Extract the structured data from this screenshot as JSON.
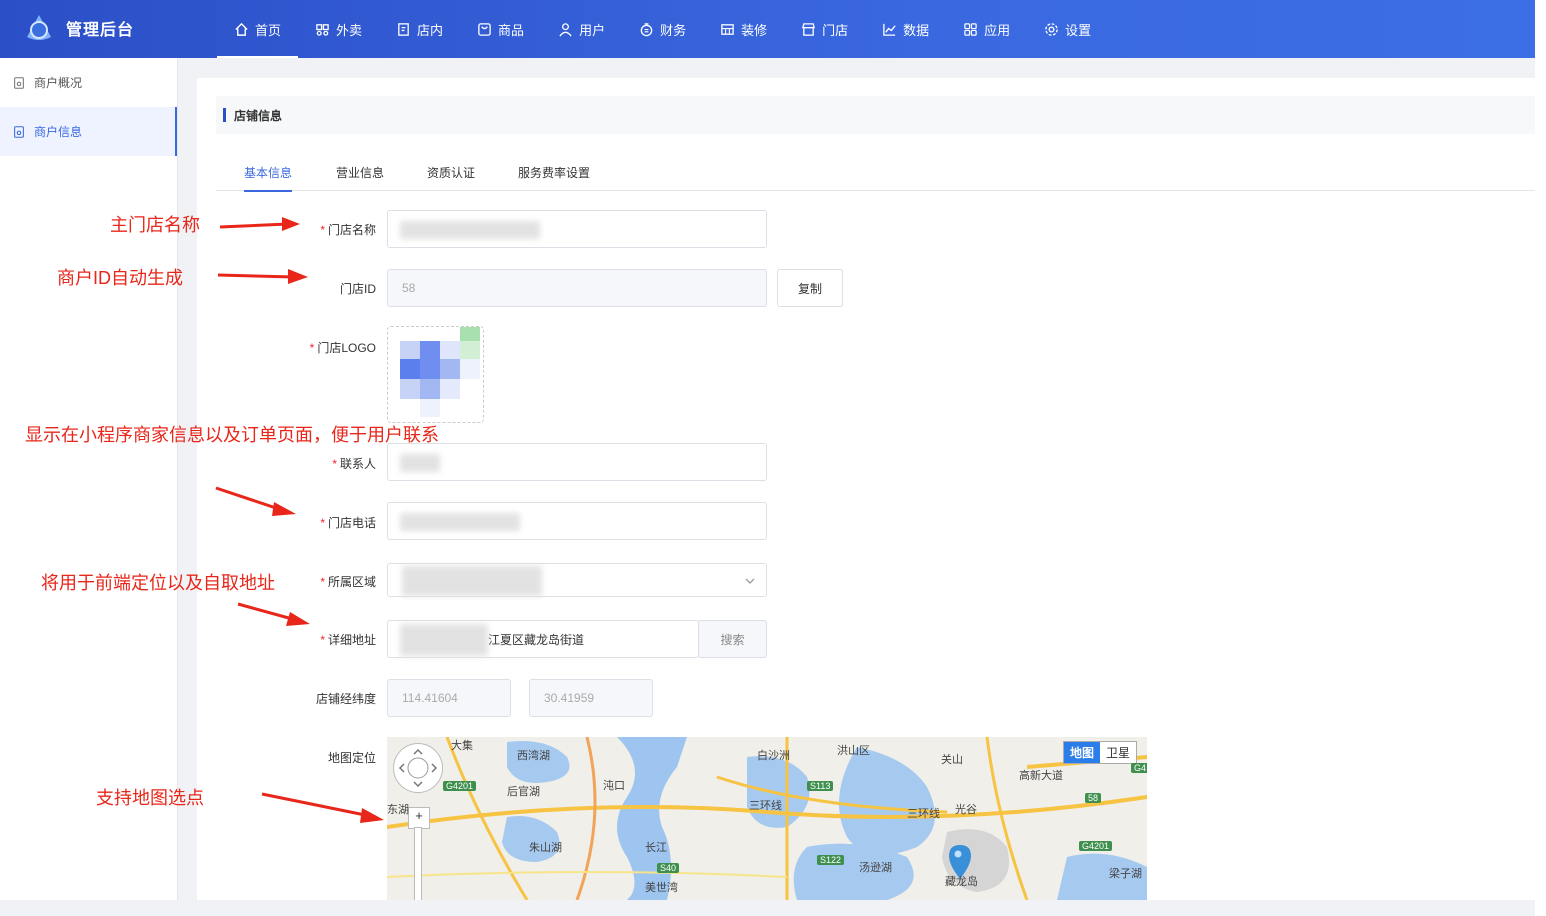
{
  "brand": {
    "title": "管理后台"
  },
  "nav": [
    {
      "label": "首页",
      "icon": "home-icon"
    },
    {
      "label": "外卖",
      "icon": "delivery-icon"
    },
    {
      "label": "店内",
      "icon": "dine-in-icon"
    },
    {
      "label": "商品",
      "icon": "goods-icon"
    },
    {
      "label": "用户",
      "icon": "user-icon"
    },
    {
      "label": "财务",
      "icon": "finance-icon"
    },
    {
      "label": "装修",
      "icon": "decorate-icon"
    },
    {
      "label": "门店",
      "icon": "store-icon"
    },
    {
      "label": "数据",
      "icon": "chart-icon"
    },
    {
      "label": "应用",
      "icon": "apps-icon"
    },
    {
      "label": "设置",
      "icon": "gear-icon"
    }
  ],
  "sidebar": {
    "items": [
      {
        "label": "商户概况"
      },
      {
        "label": "商户信息"
      }
    ]
  },
  "section": {
    "title": "店铺信息"
  },
  "tabs": [
    {
      "label": "基本信息"
    },
    {
      "label": "营业信息"
    },
    {
      "label": "资质认证"
    },
    {
      "label": "服务费率设置"
    }
  ],
  "form": {
    "store_name_label": "门店名称",
    "store_id_label": "门店ID",
    "store_id_value": "58",
    "copy_button": "复制",
    "logo_label": "门店LOGO",
    "contact_label": "联系人",
    "phone_label": "门店电话",
    "region_label": "所属区域",
    "address_label": "详细地址",
    "address_value": "江夏区藏龙岛街道",
    "search_button": "搜索",
    "coords_label": "店铺经纬度",
    "longitude": "114.41604",
    "latitude": "30.41959",
    "map_label": "地图定位"
  },
  "annotations": {
    "store_name": "主门店名称",
    "store_id": "商户ID自动生成",
    "contact_info": "显示在小程序商家信息以及订单页面，便于用户联系",
    "location": "将用于前端定位以及自取地址",
    "map_pick": "支持地图选点"
  },
  "map": {
    "switch_map": "地图",
    "switch_satellite": "卫星",
    "zoom_in": "+",
    "labels": [
      "大集",
      "西湾湖",
      "后官湖",
      "沌口",
      "白沙洲",
      "洪山区",
      "关山",
      "高新大道",
      "三环线",
      "三环线",
      "光谷",
      "汤逊湖",
      "藏龙岛",
      "梁子湖",
      "长江",
      "东湖",
      "朱山湖",
      "美世湾"
    ],
    "roads": [
      "G4201",
      "S113",
      "S122",
      "S40",
      "G4201",
      "58",
      "G4"
    ]
  },
  "colors": {
    "accent": "#3a68e0",
    "nav_bg": "#2b4fc7",
    "required": "#f5222d",
    "annotation": "#e8261a"
  }
}
